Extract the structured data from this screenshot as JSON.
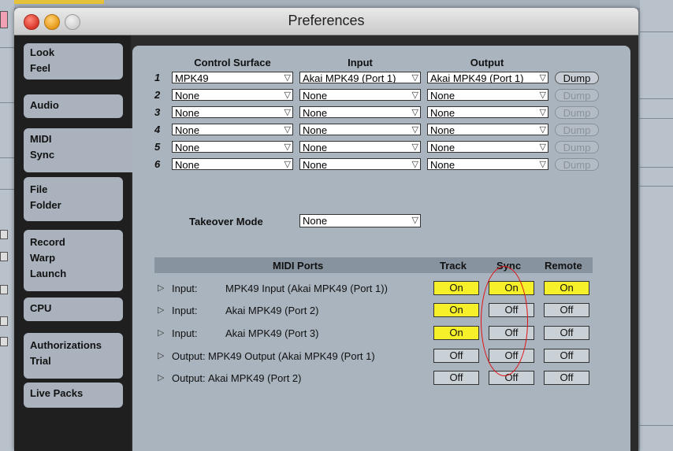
{
  "window": {
    "title": "Preferences"
  },
  "sidebar": {
    "tabs": [
      {
        "lines": [
          "Look",
          "Feel"
        ]
      },
      {
        "lines": [
          "Audio"
        ]
      },
      {
        "lines": [
          "MIDI",
          "Sync"
        ],
        "active": true
      },
      {
        "lines": [
          "File",
          "Folder"
        ]
      },
      {
        "lines": [
          "Record",
          "Warp",
          "Launch"
        ]
      },
      {
        "lines": [
          "CPU"
        ]
      },
      {
        "lines": [
          "Authorizations",
          "Trial"
        ]
      },
      {
        "lines": [
          "Live Packs"
        ]
      }
    ]
  },
  "control_surfaces": {
    "headers": {
      "surface": "Control Surface",
      "input": "Input",
      "output": "Output"
    },
    "rows": [
      {
        "num": "1",
        "surface": "MPK49",
        "input": "Akai MPK49 (Port 1)",
        "output": "Akai MPK49 (Port 1)",
        "dump": "Dump",
        "dump_enabled": true
      },
      {
        "num": "2",
        "surface": "None",
        "input": "None",
        "output": "None",
        "dump": "Dump",
        "dump_enabled": false
      },
      {
        "num": "3",
        "surface": "None",
        "input": "None",
        "output": "None",
        "dump": "Dump",
        "dump_enabled": false
      },
      {
        "num": "4",
        "surface": "None",
        "input": "None",
        "output": "None",
        "dump": "Dump",
        "dump_enabled": false
      },
      {
        "num": "5",
        "surface": "None",
        "input": "None",
        "output": "None",
        "dump": "Dump",
        "dump_enabled": false
      },
      {
        "num": "6",
        "surface": "None",
        "input": "None",
        "output": "None",
        "dump": "Dump",
        "dump_enabled": false
      }
    ]
  },
  "takeover": {
    "label": "Takeover Mode",
    "value": "None"
  },
  "midi_ports": {
    "headers": {
      "ports": "MIDI Ports",
      "track": "Track",
      "sync": "Sync",
      "remote": "Remote"
    },
    "rows": [
      {
        "kind": "Input:",
        "name": "MPK49 Input (Akai MPK49 (Port 1))",
        "track": "On",
        "sync": "On",
        "remote": "On"
      },
      {
        "kind": "Input:",
        "name": "Akai MPK49 (Port 2)",
        "track": "On",
        "sync": "Off",
        "remote": "Off"
      },
      {
        "kind": "Input:",
        "name": "Akai MPK49 (Port 3)",
        "track": "On",
        "sync": "Off",
        "remote": "Off"
      },
      {
        "kind": "Output:",
        "name": "MPK49 Output (Akai MPK49 (Port 1)",
        "track": "Off",
        "sync": "Off",
        "remote": "Off"
      },
      {
        "kind": "Output:",
        "name": "Akai MPK49 (Port 2)",
        "track": "Off",
        "sync": "Off",
        "remote": "Off"
      }
    ]
  },
  "colors": {
    "on": "#f5f02a",
    "off": "#c9d0d6",
    "annotation": "#e01010"
  },
  "icons": {
    "dropdown": "chevron-down-icon",
    "expand": "disclosure-triangle-icon"
  }
}
